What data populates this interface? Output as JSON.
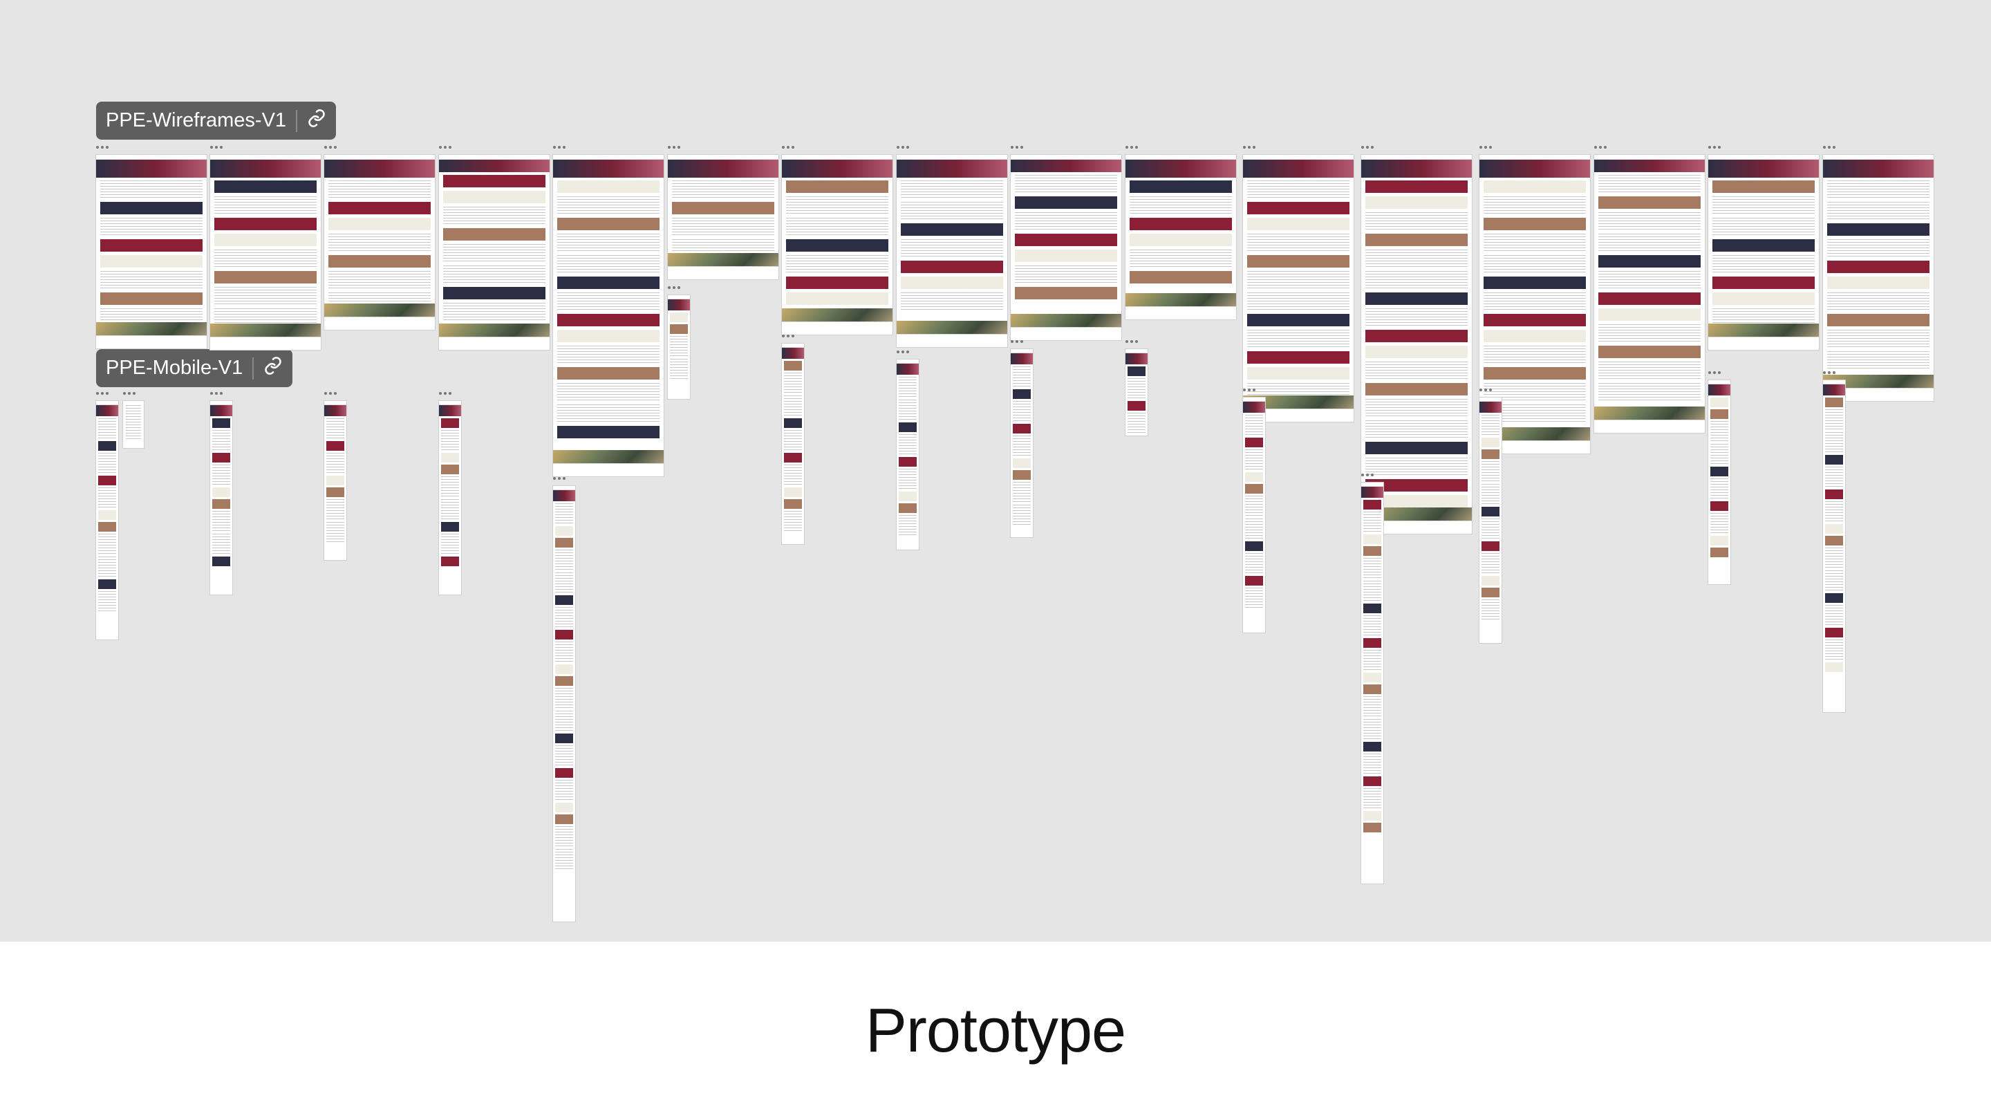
{
  "canvas": {
    "background": "#e5e5e5",
    "tags": [
      {
        "label": "PPE-Wireframes-V1",
        "icon": "link-icon"
      },
      {
        "label": "PPE-Mobile-V1",
        "icon": "link-icon"
      }
    ]
  },
  "caption": {
    "title": "Prototype"
  },
  "colors": {
    "brand_red": "#8b1f35",
    "brand_navy": "#2b2e45",
    "tan": "#a67a60",
    "cream": "#efece2"
  }
}
